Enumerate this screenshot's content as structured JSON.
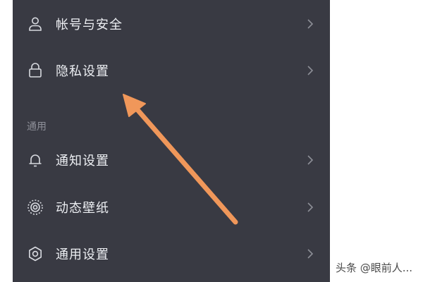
{
  "settings": {
    "account_items": [
      {
        "label": "帐号与安全",
        "icon": "user-icon"
      },
      {
        "label": "隐私设置",
        "icon": "lock-icon"
      }
    ],
    "general_section": {
      "title": "通用",
      "items": [
        {
          "label": "通知设置",
          "icon": "bell-icon"
        },
        {
          "label": "动态壁纸",
          "icon": "live-wallpaper-icon"
        },
        {
          "label": "通用设置",
          "icon": "gear-icon"
        }
      ]
    }
  },
  "annotation": {
    "arrow_color": "#f0975a",
    "target": "隐私设置"
  },
  "watermark": "头条 @眼前人..."
}
